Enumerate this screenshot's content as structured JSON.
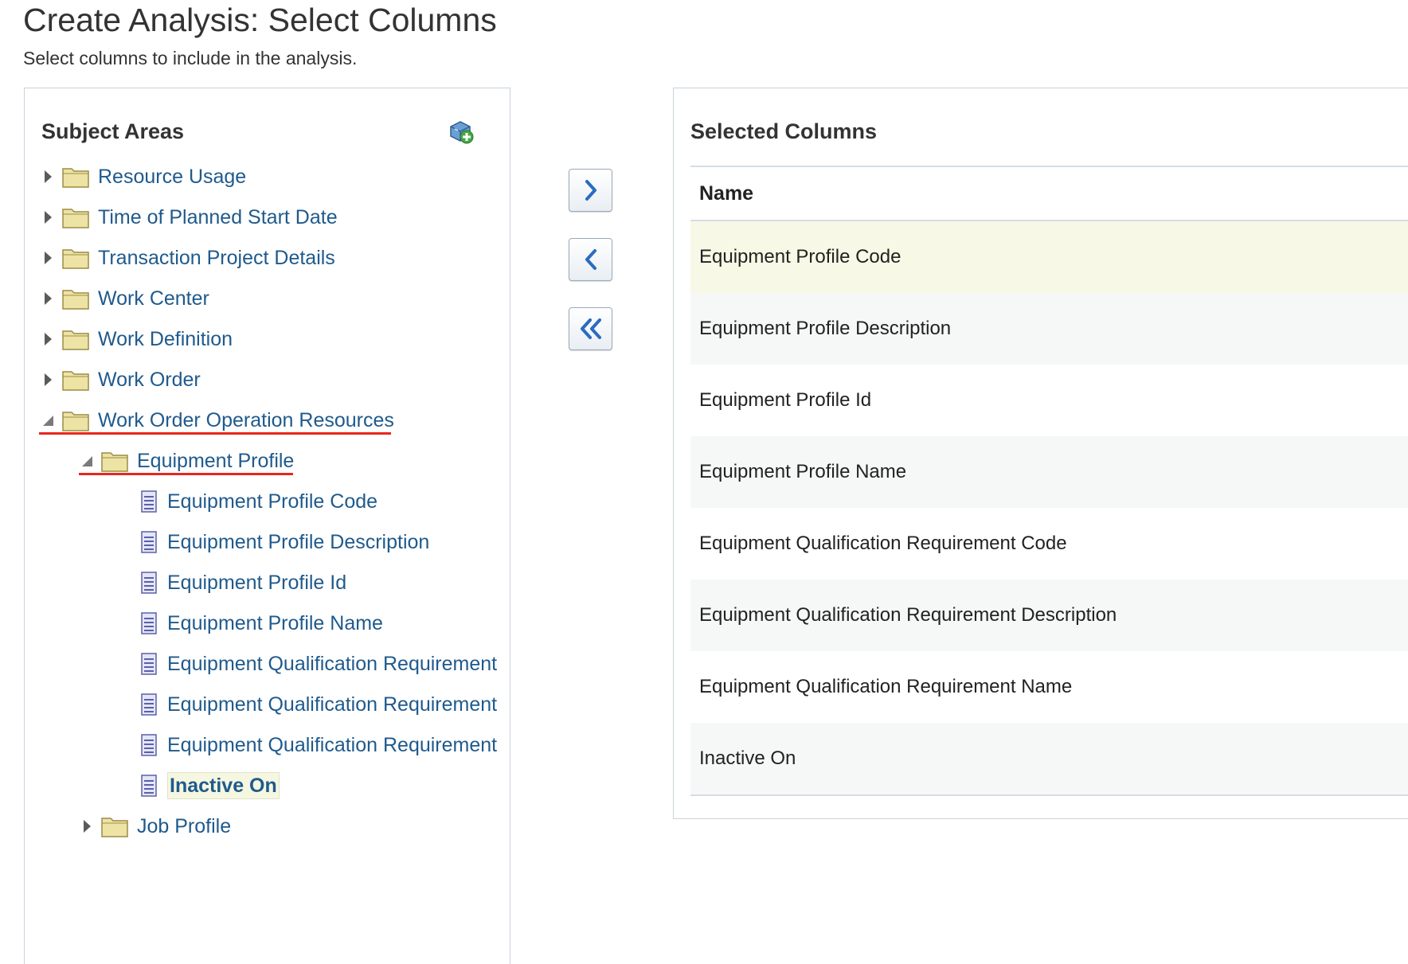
{
  "page": {
    "title": "Create Analysis: Select Columns",
    "subtitle": "Select columns to include in the analysis."
  },
  "subject_areas": {
    "title": "Subject Areas",
    "add_icon": "add-subject-area-icon",
    "items": [
      {
        "label": "Resource Usage",
        "type": "folder",
        "expanded": false
      },
      {
        "label": "Time of Planned Start Date",
        "type": "folder",
        "expanded": false
      },
      {
        "label": "Transaction Project Details",
        "type": "folder",
        "expanded": false
      },
      {
        "label": "Work Center",
        "type": "folder",
        "expanded": false
      },
      {
        "label": "Work Definition",
        "type": "folder",
        "expanded": false
      },
      {
        "label": "Work Order",
        "type": "folder",
        "expanded": false
      },
      {
        "label": "Work Order Operation Resources",
        "type": "folder",
        "expanded": true,
        "highlighted": true
      },
      {
        "label": "Equipment Profile",
        "type": "folder",
        "expanded": true,
        "highlighted": true
      },
      {
        "label": "Equipment Profile Code",
        "type": "column"
      },
      {
        "label": "Equipment Profile Description",
        "type": "column"
      },
      {
        "label": "Equipment Profile Id",
        "type": "column"
      },
      {
        "label": "Equipment Profile Name",
        "type": "column"
      },
      {
        "label": "Equipment Qualification Requirement",
        "type": "column"
      },
      {
        "label": "Equipment Qualification Requirement",
        "type": "column"
      },
      {
        "label": "Equipment Qualification Requirement",
        "type": "column"
      },
      {
        "label": "Inactive On",
        "type": "column",
        "selected": true
      },
      {
        "label": "Job Profile",
        "type": "folder",
        "expanded": false
      }
    ]
  },
  "shuttle": {
    "add_icon": "chevron-right-icon",
    "remove_icon": "chevron-left-icon",
    "remove_all_icon": "double-chevron-left-icon"
  },
  "selected_columns": {
    "title": "Selected Columns",
    "header": "Name",
    "rows": [
      "Equipment Profile Code",
      "Equipment Profile Description",
      "Equipment Profile Id",
      "Equipment Profile Name",
      "Equipment Qualification Requirement Code",
      "Equipment Qualification Requirement Description",
      "Equipment Qualification Requirement Name",
      "Inactive On"
    ]
  },
  "colors": {
    "link": "#1f5a8c",
    "annotation_underline": "#e8271e",
    "row_highlight": "#f8f8e6",
    "row_alt": "#f6f7f7"
  }
}
